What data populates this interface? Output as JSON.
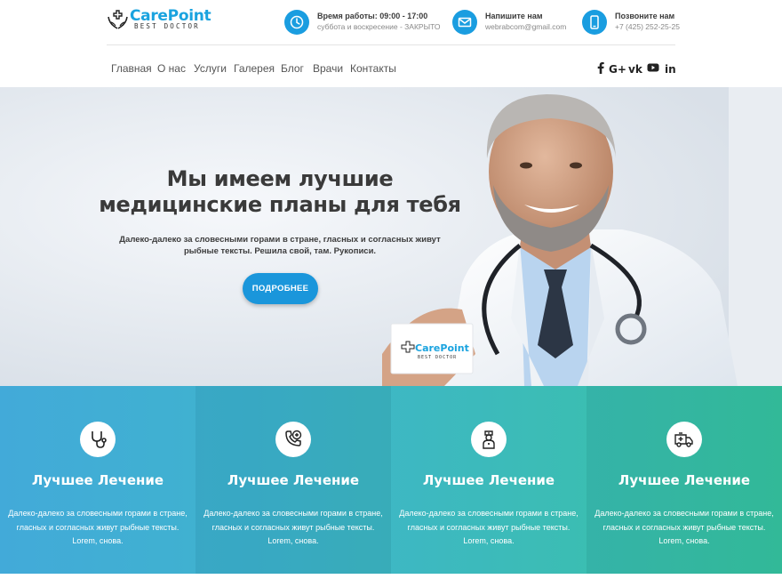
{
  "brand": {
    "name": "CarePoint",
    "tagline": "BEST DOCTOR",
    "accent_color": "#1aa3df"
  },
  "contacts": [
    {
      "icon": "clock-icon",
      "title": "Время работы: 09:00 - 17:00",
      "subtitle": "суббота и воскресение - ЗАКРЫТО"
    },
    {
      "icon": "envelope-icon",
      "title": "Напишите нам",
      "subtitle": "webrabcom@gmail.com"
    },
    {
      "icon": "phone-icon",
      "title": "Позвоните нам",
      "subtitle": "+7 (425) 252-25-25"
    }
  ],
  "nav": {
    "items": [
      "Главная",
      "О нас",
      "Услуги",
      "Галерея",
      "Блог",
      "Врачи",
      "Контакты"
    ],
    "social": [
      "facebook-icon",
      "google-plus-icon",
      "vk-icon",
      "youtube-icon",
      "linkedin-icon"
    ],
    "google_plus_label": "G+",
    "vk_label": "vk",
    "linkedin_label": "in"
  },
  "hero": {
    "title_line1": "Мы имеем лучшие",
    "title_line2": "медицинские планы для тебя",
    "text": "Далеко-далеко за словесными горами в стране, гласных и согласных живут рыбные тексты. Решила свой, там. Рукописи.",
    "button": "ПОДРОБНЕЕ",
    "card_name": "CarePoint",
    "card_tagline": "BEST DOCTOR"
  },
  "features": [
    {
      "icon": "stethoscope-icon",
      "title": "Лучшее Лечение",
      "text": "Далеко-далеко за словесными горами в стране, гласных и согласных живут рыбные тексты. Lorem, снова."
    },
    {
      "icon": "phone-medical-icon",
      "title": "Лучшее Лечение",
      "text": "Далеко-далеко за словесными горами в стране, гласных и согласных живут рыбные тексты. Lorem, снова."
    },
    {
      "icon": "nurse-icon",
      "title": "Лучшее Лечение",
      "text": "Далеко-далеко за словесными горами в стране, гласных и согласных живут рыбные тексты. Lorem, снова."
    },
    {
      "icon": "ambulance-icon",
      "title": "Лучшее Лечение",
      "text": "Далеко-далеко за словесными горами в стране, гласных и согласных живут рыбные тексты. Lorem, снова."
    }
  ],
  "colors": {
    "primary": "#1a96db",
    "feature_gradient_start": "#3fa9d9",
    "feature_gradient_end": "#35c3a1"
  }
}
